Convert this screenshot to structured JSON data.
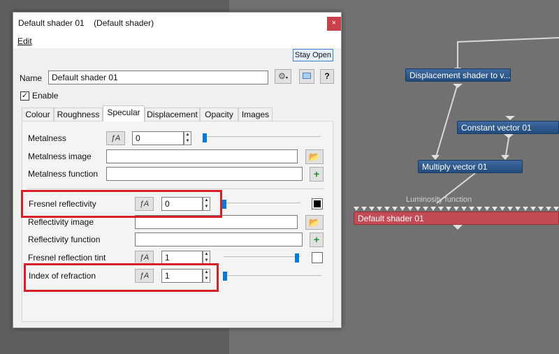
{
  "nodes": {
    "displacement": "Displacement shader to v...",
    "constant": "Constant vector 01",
    "multiply": "Multiply vector 01",
    "luminosity_label": "Luminosity function",
    "default_shader": "Default shader 01"
  },
  "dialog": {
    "title": "Default shader 01    (Default shader)",
    "close_glyph": "×",
    "menu_edit": "Edit",
    "stay_open": "Stay Open",
    "name_label": "Name",
    "name_value": "Default shader 01",
    "help_glyph": "?",
    "enable_label": "Enable",
    "enable_checked": "✓",
    "tabs": [
      "Colour",
      "Roughness",
      "Specular",
      "Displacement",
      "Opacity",
      "Images"
    ],
    "active_tab": "Specular",
    "fields": {
      "metalness_label": "Metalness",
      "metalness_value": "0",
      "metalness_image_label": "Metalness image",
      "metalness_function_label": "Metalness function",
      "fresnel_reflectivity_label": "Fresnel reflectivity",
      "fresnel_reflectivity_value": "0",
      "reflectivity_image_label": "Reflectivity image",
      "reflectivity_function_label": "Reflectivity function",
      "fresnel_tint_label": "Fresnel reflection tint",
      "fresnel_tint_value": "1",
      "ior_label": "Index of refraction",
      "ior_value": "1"
    },
    "fx_glyph": "ƒA",
    "spin_up": "▲",
    "spin_down": "▼",
    "folder_glyph": "📂",
    "plus_glyph": "+",
    "colors": {
      "highlight": "#d81e26",
      "slider": "#0a78d7",
      "fresnel_swatch": "#000000",
      "tint_swatch": "#ffffff"
    }
  }
}
